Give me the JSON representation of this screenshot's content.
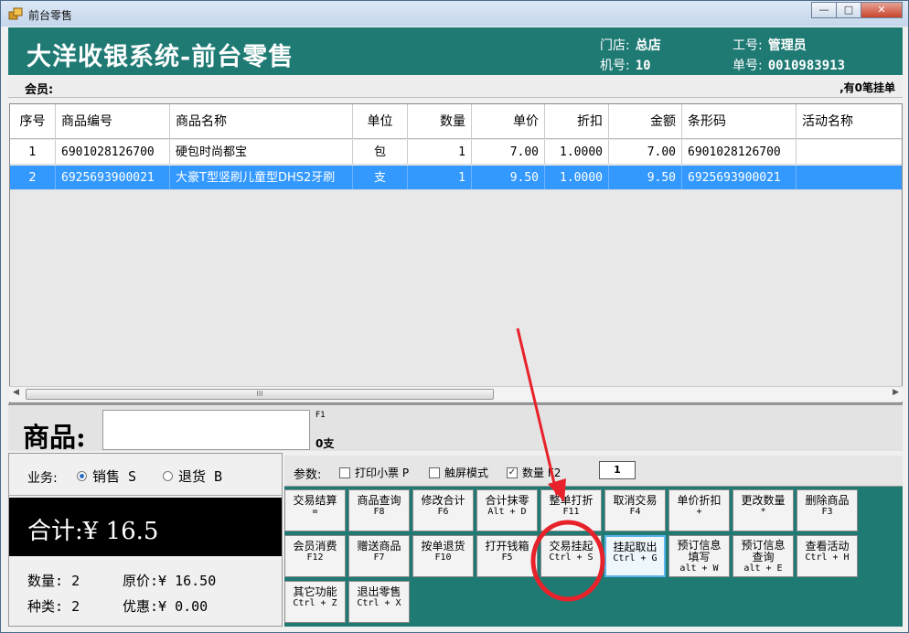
{
  "window": {
    "title": "前台零售",
    "min": "—",
    "max": "□",
    "close": "✕"
  },
  "header": {
    "title": "大洋收银系统-前台零售",
    "store_label": "门店:",
    "store_value": "总店",
    "machine_label": "机号:",
    "machine_value": "10",
    "staff_label": "工号:",
    "staff_value": "管理员",
    "order_label": "单号:",
    "order_value": "0010983913"
  },
  "member": {
    "label": "会员:",
    "hang_info": ",有0笔挂单"
  },
  "grid": {
    "columns": [
      "序号",
      "商品编号",
      "商品名称",
      "单位",
      "数量",
      "单价",
      "折扣",
      "金额",
      "条形码",
      "活动名称"
    ],
    "rows": [
      {
        "no": "1",
        "code": "6901028126700",
        "name": "硬包时尚都宝",
        "unit": "包",
        "qty": "1",
        "price": "7.00",
        "discount": "1.0000",
        "amount": "7.00",
        "barcode": "6901028126700",
        "activity": ""
      },
      {
        "no": "2",
        "code": "6925693900021",
        "name": "大豪T型竖刷儿童型DHS2牙刷",
        "unit": "支",
        "qty": "1",
        "price": "9.50",
        "discount": "1.0000",
        "amount": "9.50",
        "barcode": "6925693900021",
        "activity": ""
      }
    ],
    "scroll_thumb": "III"
  },
  "entry": {
    "label": "商品:",
    "hint": "F1",
    "count": "0支"
  },
  "business": {
    "label": "业务:",
    "sale": "销售 S",
    "return": "退货 B"
  },
  "total": {
    "text": "合计:¥ 16.5"
  },
  "stats": {
    "qty_label": "数量:",
    "qty_value": "2",
    "kind_label": "种类:",
    "kind_value": "2",
    "orig_label": "原价:",
    "orig_value": "¥ 16.50",
    "disc_label": "优惠:",
    "disc_value": "¥ 0.00"
  },
  "params": {
    "label": "参数:",
    "print": "打印小票 P",
    "touch": "触屏模式",
    "qty": "数量 F2",
    "qty_checked": "✓",
    "qty_value": "1"
  },
  "buttons": [
    {
      "label": "交易结算",
      "key": "="
    },
    {
      "label": "商品查询",
      "key": "F8"
    },
    {
      "label": "修改合计",
      "key": "F6"
    },
    {
      "label": "合计抹零",
      "key": "Alt + D"
    },
    {
      "label": "整单打折",
      "key": "F11"
    },
    {
      "label": "取消交易",
      "key": "F4"
    },
    {
      "label": "单价折扣",
      "key": "+"
    },
    {
      "label": "更改数量",
      "key": "*"
    },
    {
      "label": "删除商品",
      "key": "F3"
    },
    {
      "label": "会员消费",
      "key": "F12"
    },
    {
      "label": "赠送商品",
      "key": "F7"
    },
    {
      "label": "按单退货",
      "key": "F10"
    },
    {
      "label": "打开钱箱",
      "key": "F5"
    },
    {
      "label": "交易挂起",
      "key": "Ctrl + S"
    },
    {
      "label": "挂起取出",
      "key": "Ctrl + G"
    },
    {
      "label": "预订信息填写",
      "key": "alt + W"
    },
    {
      "label": "预订信息查询",
      "key": "alt + E"
    },
    {
      "label": "查看活动",
      "key": "Ctrl + H"
    },
    {
      "label": "其它功能",
      "key": "Ctrl + Z"
    },
    {
      "label": "退出零售",
      "key": "Ctrl + X"
    }
  ],
  "colors": {
    "header_bg": "#1f7a74",
    "selection": "#3399ff",
    "annotation": "#e8222a"
  }
}
